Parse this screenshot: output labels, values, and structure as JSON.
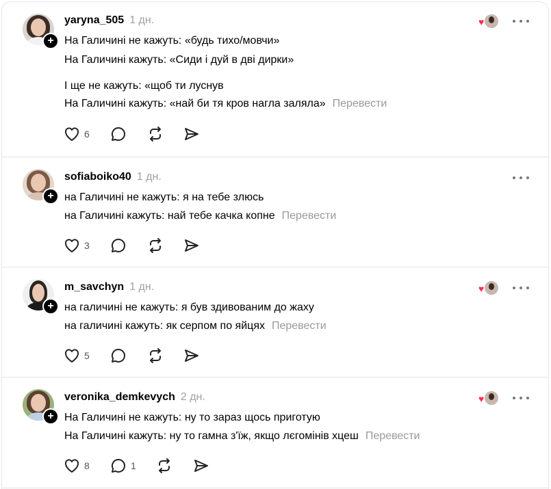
{
  "posts": [
    {
      "username": "yaryna_505",
      "time": "1 дн.",
      "lines": [
        "На Галичині не кажуть: «будь тихо/мовчи»",
        "На Галичині кажуть: «Сиди і дуй в дві дирки»",
        "І ще не кажуть: «щоб ти луснув",
        "На Галичині кажуть: «най би тя кров нагла заляла»"
      ],
      "translate_label": "Перевести",
      "likes": "6",
      "replies": "",
      "liked_by_author": true
    },
    {
      "username": "sofiaboiko40",
      "time": "1 дн.",
      "lines": [
        "на Галичині не кажуть: я на тебе злюсь",
        "на Галичині кажуть: най тебе качка копне"
      ],
      "translate_label": "Перевести",
      "likes": "3",
      "replies": "",
      "liked_by_author": false
    },
    {
      "username": "m_savchyn",
      "time": "1 дн.",
      "lines": [
        "на галичині не кажуть: я був здивованим до жаху",
        "на галичині кажуть: як серпом по яйцях"
      ],
      "translate_label": "Перевести",
      "likes": "5",
      "replies": "",
      "liked_by_author": true
    },
    {
      "username": "veronika_demkevych",
      "time": "2 дн.",
      "lines": [
        "На Галичині не кажуть: ну то зараз щось приготую",
        "На Галичині кажуть: ну то гамна з'їж, якщо лєгомінів хцеш"
      ],
      "translate_label": "Перевести",
      "likes": "8",
      "replies": "1",
      "liked_by_author": true
    }
  ],
  "icons": {
    "like": "heart-outline-icon",
    "reply": "speech-bubble-icon",
    "repost": "repost-arrows-icon",
    "share": "send-plane-icon",
    "more": "ellipsis-icon",
    "follow": "plus-icon"
  },
  "colors": {
    "text": "#000000",
    "muted": "#999999",
    "heart": "#ff2d55",
    "divider": "#e3e3e3"
  }
}
